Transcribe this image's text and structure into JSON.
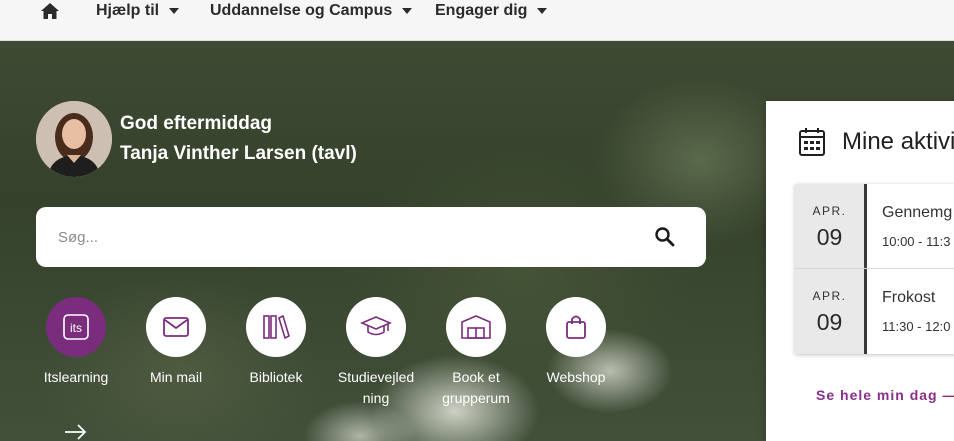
{
  "nav": {
    "home_icon": "home-icon",
    "items": [
      {
        "label": "Hjælp til"
      },
      {
        "label": "Uddannelse og Campus"
      },
      {
        "label": "Engager dig"
      }
    ]
  },
  "greeting": {
    "line1": "God eftermiddag",
    "line2": "Tanja Vinther Larsen (tavl)"
  },
  "search": {
    "placeholder": "Søg...",
    "icon": "search-icon"
  },
  "shortcuts": [
    {
      "label": "Itslearning",
      "icon": "itslearning-icon"
    },
    {
      "label": "Min mail",
      "icon": "mail-icon"
    },
    {
      "label": "Bibliotek",
      "icon": "books-icon"
    },
    {
      "label": "Studievejled ning",
      "icon": "graduation-cap-icon"
    },
    {
      "label": "Book et grupperum",
      "icon": "room-icon"
    },
    {
      "label": "Webshop",
      "icon": "shopping-bag-icon"
    }
  ],
  "activities": {
    "title": "Mine aktivit",
    "icon": "calendar-icon",
    "events": [
      {
        "month": "APR.",
        "day": "09",
        "title": "Gennemg",
        "time": "10:00 - 11:3"
      },
      {
        "month": "APR.",
        "day": "09",
        "title": "Frokost",
        "time": "11:30 - 12:0"
      }
    ],
    "see_all": "Se hele min dag —"
  },
  "colors": {
    "accent": "#7b2d7d",
    "link": "#8a2f8c",
    "nav_bg": "#f6f6f6"
  }
}
